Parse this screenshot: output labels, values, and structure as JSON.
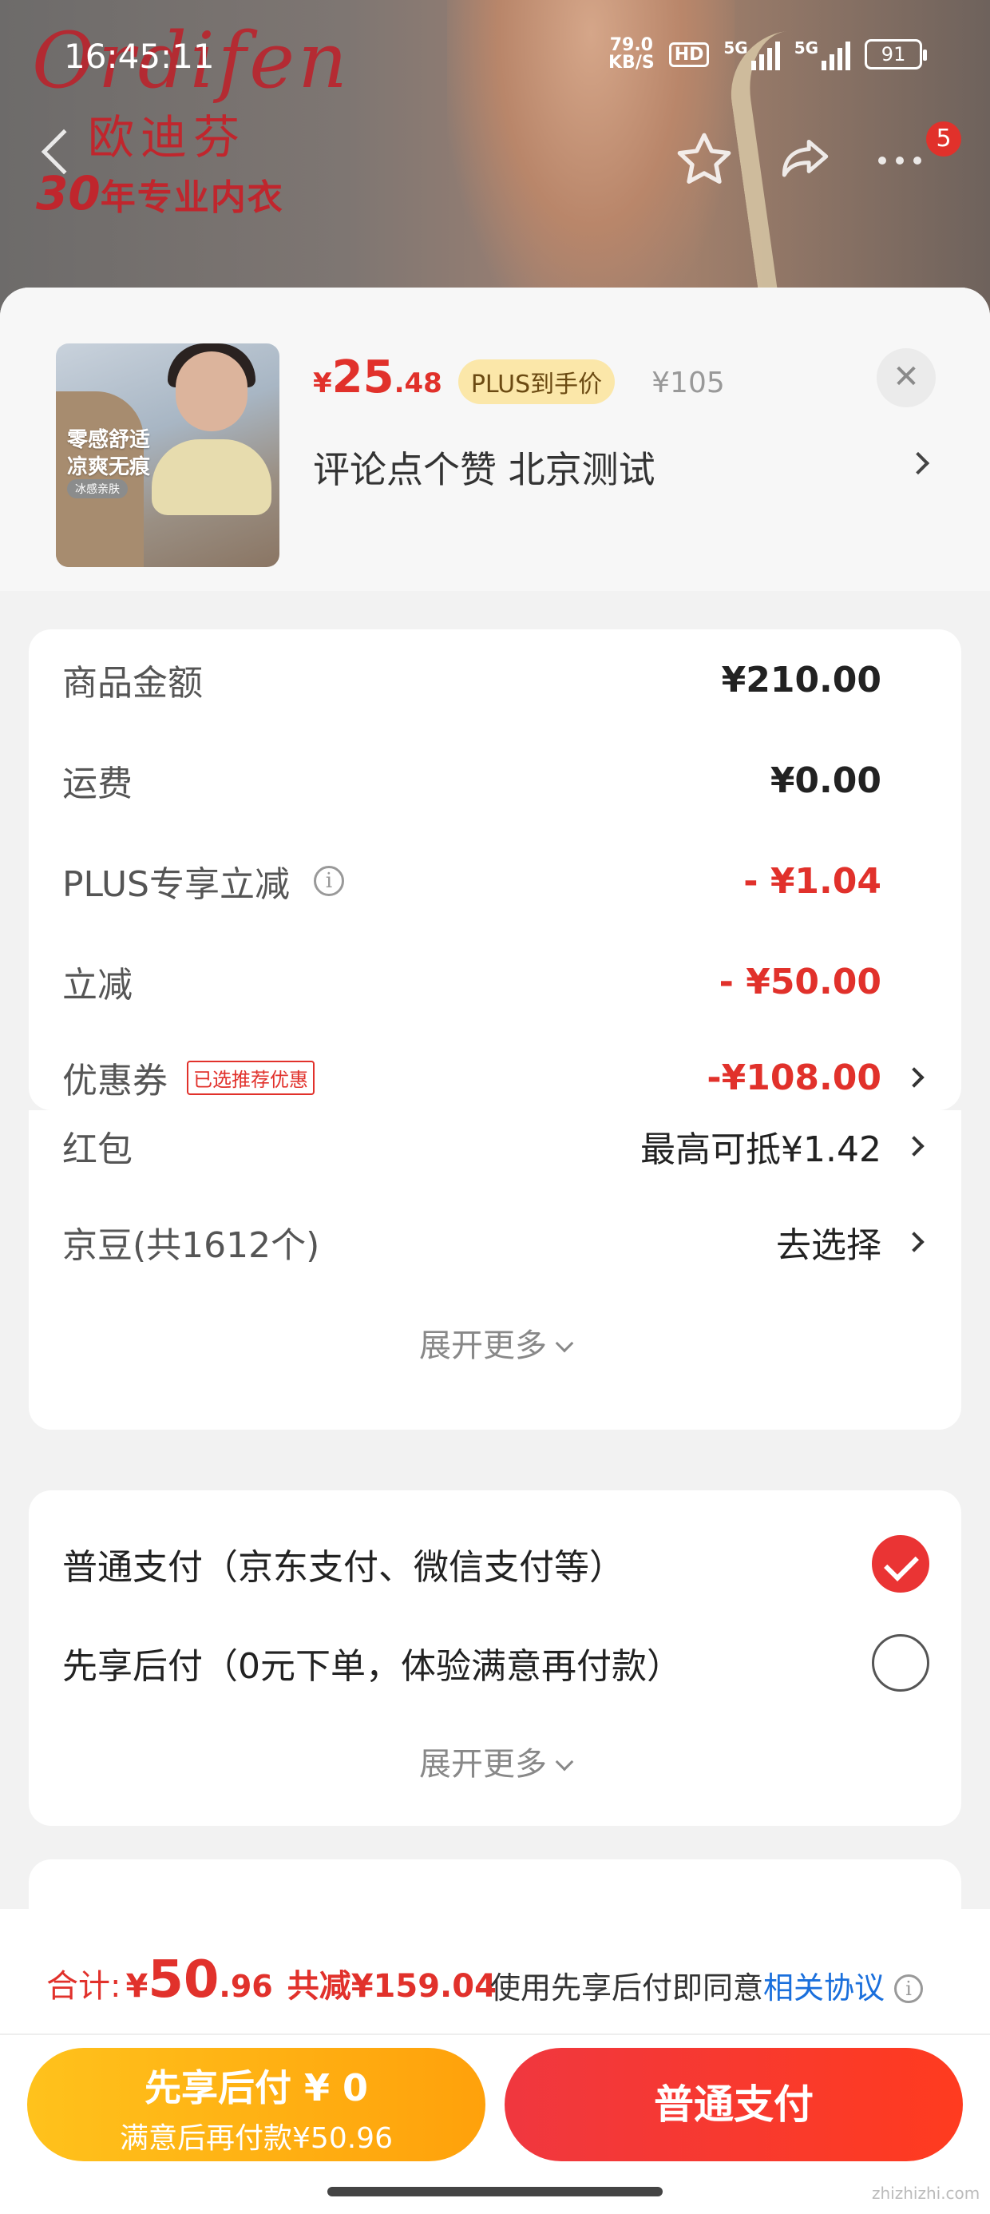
{
  "banner": {
    "brand_en": "Ordifen",
    "brand_cn": "欧迪芬",
    "brand_years": "30",
    "brand_slogan": "年专业内衣"
  },
  "status_bar": {
    "time": "16:45:11",
    "speed_value": "79.0",
    "speed_unit": "KB/S",
    "hd": "HD",
    "net1": "5G",
    "net2": "5G",
    "battery": "91"
  },
  "nav": {
    "badge": "5"
  },
  "product": {
    "thumb_text1": "零感舒适",
    "thumb_text2": "凉爽无痕",
    "thumb_text3": "冰感亲肤",
    "price_symbol": "¥",
    "price_int": "25",
    "price_dec": ".48",
    "plus_tag": "PLUS到手价",
    "original_price": "¥105",
    "spec": "评论点个赞  北京测试",
    "close": "✕"
  },
  "summary": {
    "rows": [
      {
        "label": "商品金额",
        "value": "¥210.00"
      },
      {
        "label": "运费",
        "value": "¥0.00"
      },
      {
        "label": "PLUS专享立减",
        "value": "- ¥1.04"
      },
      {
        "label": "立减",
        "value": "- ¥50.00"
      },
      {
        "label": "优惠券",
        "tag": "已选推荐优惠",
        "value": "-¥108.00"
      },
      {
        "label": "红包",
        "value": "最高可抵¥1.42"
      },
      {
        "label": "京豆(共1612个)",
        "value": "去选择"
      }
    ],
    "expand": "展开更多"
  },
  "payment": {
    "options": [
      {
        "label": "普通支付（京东支付、微信支付等）",
        "selected": true
      },
      {
        "label": "先享后付（0元下单，体验满意再付款）",
        "selected": false
      }
    ],
    "expand": "展开更多"
  },
  "footer": {
    "total_label": "合计:",
    "total_symbol": "¥",
    "total_int": "50",
    "total_dec": ".96",
    "total_saving": "共减¥159.04",
    "agree_text": "使用先享后付即同意",
    "agree_link": "相关协议",
    "btn_later_line1": "先享后付 ¥ 0",
    "btn_later_line2": "满意后再付款¥50.96",
    "btn_normal": "普通支付"
  },
  "watermark": "zhizhizhi.com",
  "colors": {
    "accent_red": "#e1312b",
    "plus_gold": "#fbe7a9",
    "later_yellow": "#ffb315",
    "link_blue": "#1a6fdc"
  }
}
